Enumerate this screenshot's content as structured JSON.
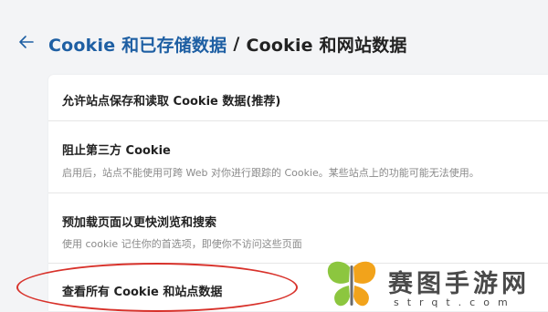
{
  "header": {
    "back_icon": "arrow-left-icon",
    "breadcrumb_parent": "Cookie 和已存储数据",
    "breadcrumb_separator": "/",
    "breadcrumb_current": "Cookie 和网站数据"
  },
  "settings": {
    "allow_cookies_label": "允许站点保存和读取 Cookie 数据(推荐)",
    "block_third_party_label": "阻止第三方 Cookie",
    "block_third_party_desc": "启用后，站点不能使用可跨 Web 对你进行跟踪的 Cookie。某些站点上的功能可能无法使用。",
    "preload_label": "预加载页面以更快浏览和搜索",
    "preload_desc": "使用 cookie 记住你的首选项，即使你不访问这些页面",
    "view_all_label": "查看所有 Cookie 和站点数据"
  },
  "watermark": {
    "text": "赛图手游网",
    "subtext": "strqt.com"
  },
  "colors": {
    "accent": "#1e5fa3",
    "highlight": "#d8322b",
    "watermark_green": "#8cc63f",
    "watermark_orange": "#f2a31b"
  }
}
